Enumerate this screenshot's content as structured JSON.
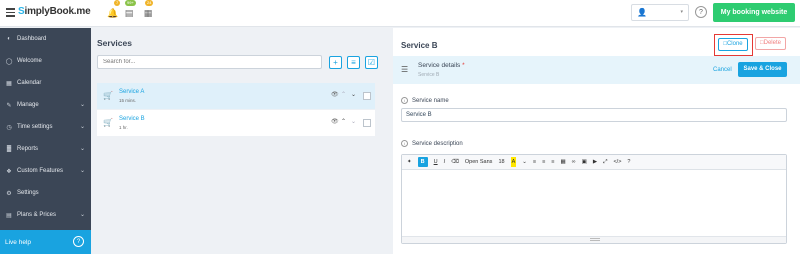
{
  "app": {
    "logo_s": "S",
    "logo_rest": "implyBook.me",
    "my_booking_website": "My booking website",
    "badges": [
      "7",
      "99+",
      "24"
    ]
  },
  "sidebar": {
    "items": [
      {
        "label": "Dashboard",
        "icon": "dashboard-icon",
        "chevron": false
      },
      {
        "label": "Welcome",
        "icon": "welcome-icon",
        "chevron": false
      },
      {
        "label": "Calendar",
        "icon": "calendar-icon",
        "chevron": false
      },
      {
        "label": "Manage",
        "icon": "manage-icon",
        "chevron": true
      },
      {
        "label": "Time settings",
        "icon": "clock-icon",
        "chevron": true
      },
      {
        "label": "Reports",
        "icon": "reports-icon",
        "chevron": true
      },
      {
        "label": "Custom Features",
        "icon": "puzzle-icon",
        "chevron": true
      },
      {
        "label": "Settings",
        "icon": "gear-icon",
        "chevron": false
      },
      {
        "label": "Plans & Prices",
        "icon": "plans-icon",
        "chevron": true
      }
    ],
    "live_help": "Live help"
  },
  "services": {
    "title": "Services",
    "search_placeholder": "Search for...",
    "list": [
      {
        "name": "Service A",
        "duration": "15 mins."
      },
      {
        "name": "Service B",
        "duration": "1 hr."
      }
    ]
  },
  "detail": {
    "title": "Service B",
    "clone": "Clone",
    "delete": "Delete",
    "section_label": "Service details",
    "section_required": "*",
    "section_sub": "Service B",
    "cancel": "Cancel",
    "save_close": "Save & Close",
    "service_name_label": "Service name",
    "service_name_value": "Service B",
    "service_desc_label": "Service description",
    "toolbar": {
      "font": "Open Sans",
      "size": "18"
    }
  },
  "colors": {
    "accent": "#19a3e0",
    "sidebar": "#3b4656",
    "green": "#2ecc71",
    "highlight_border": "#e53935"
  }
}
